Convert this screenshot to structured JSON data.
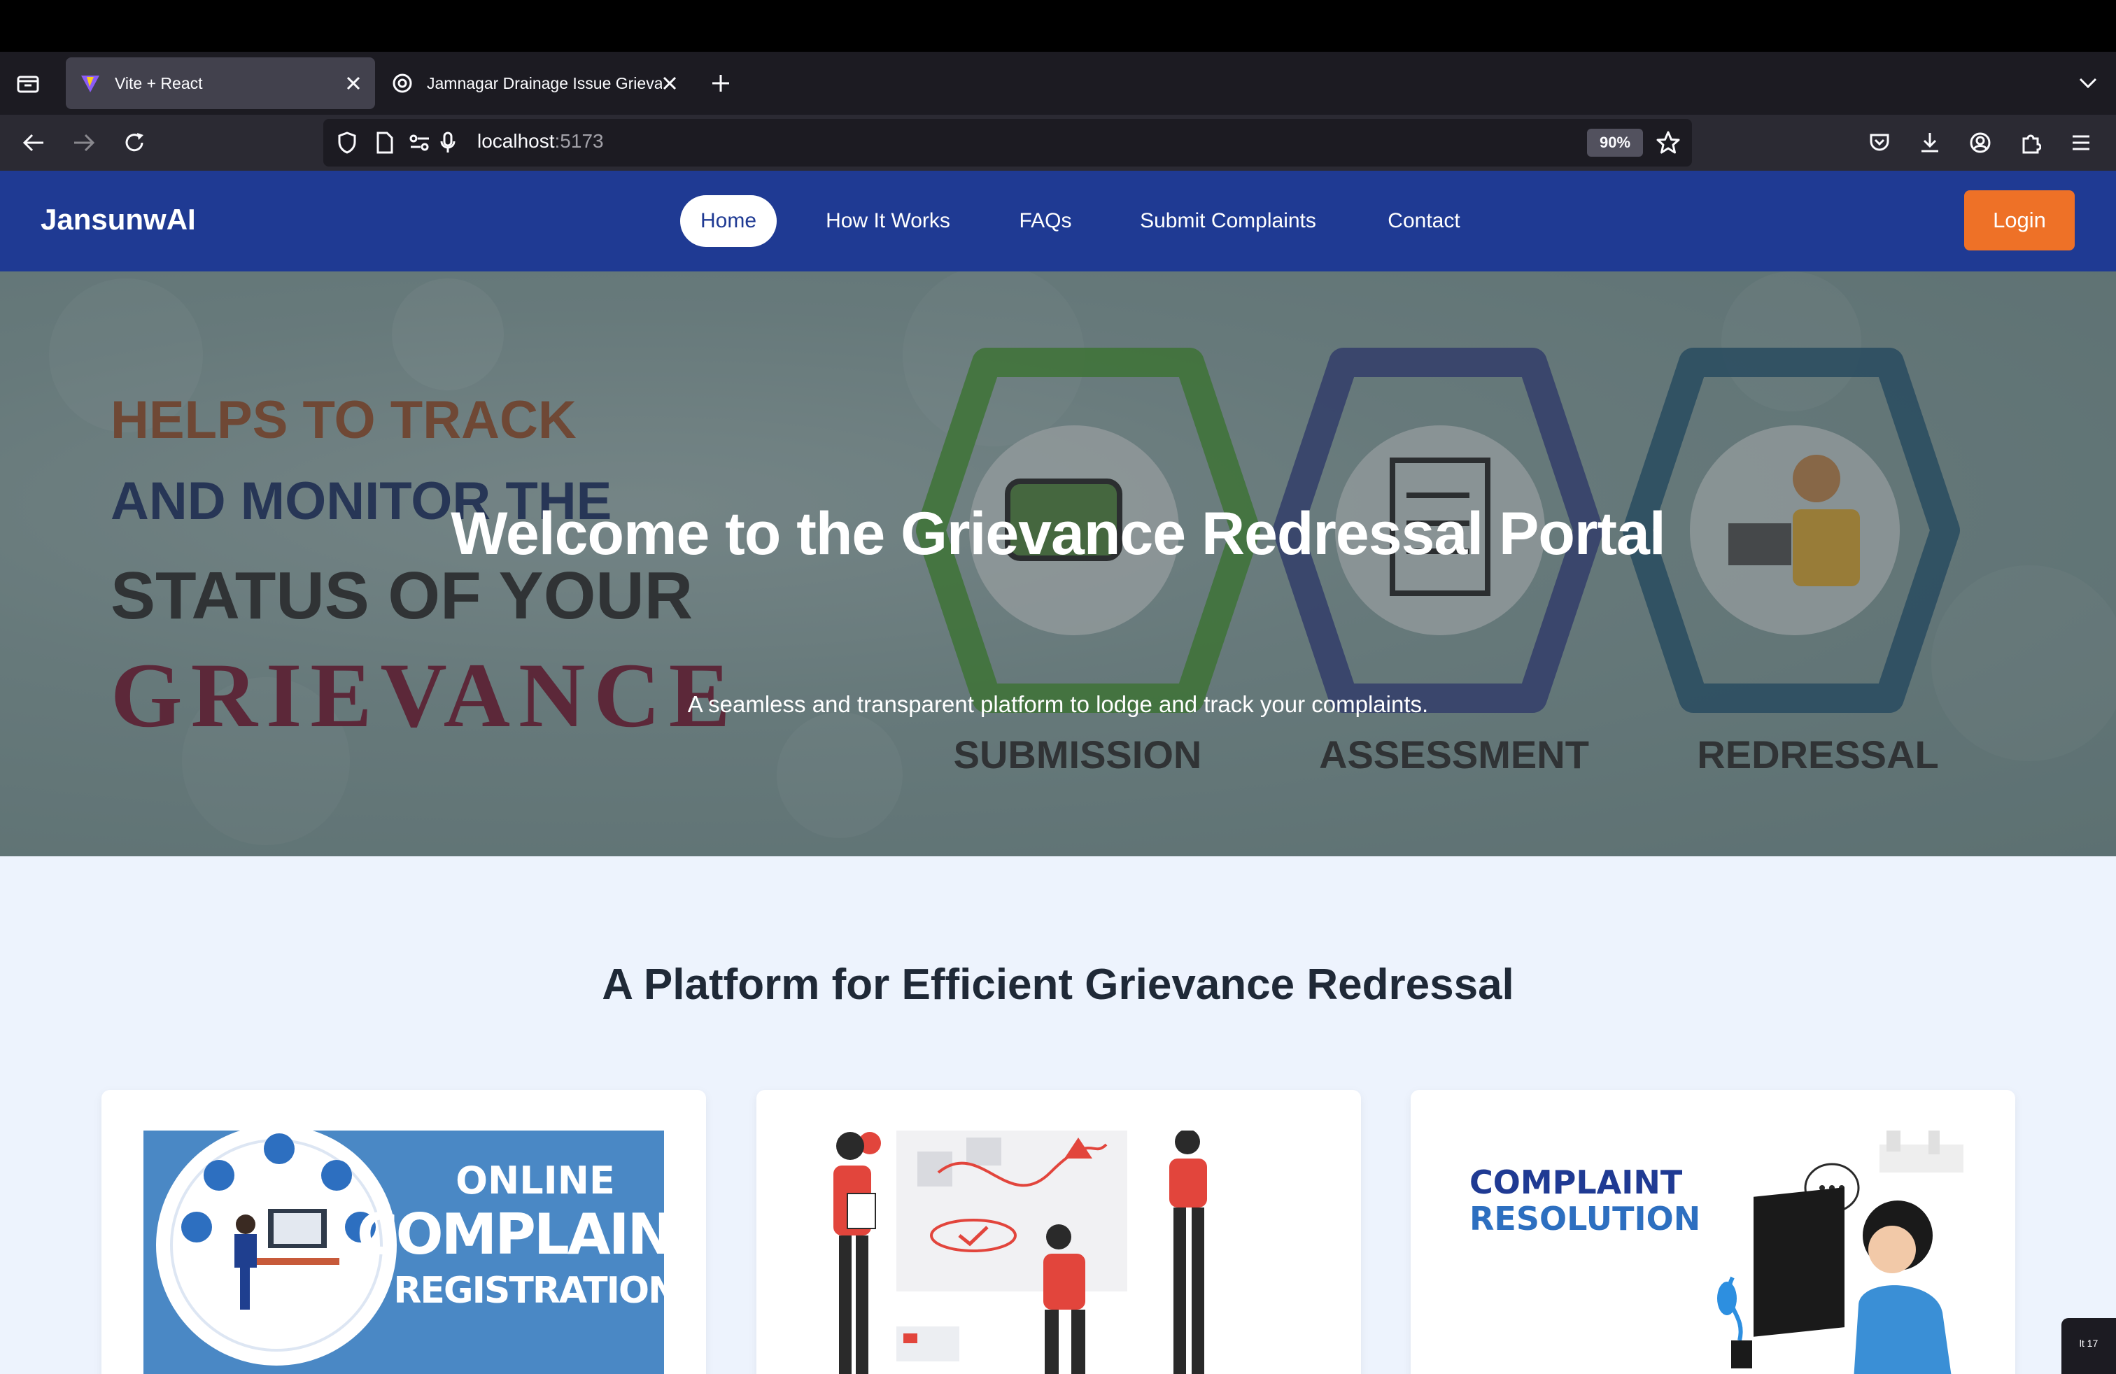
{
  "browser": {
    "tabs": [
      {
        "title": "Vite + React",
        "active": true
      },
      {
        "title": "Jamnagar Drainage Issue Grieva",
        "active": false
      }
    ],
    "url": {
      "host": "localhost",
      "port": ":5173"
    },
    "zoom": "90%"
  },
  "site": {
    "brand": "JansunwAI",
    "nav": [
      "Home",
      "How It Works",
      "FAQs",
      "Submit Complaints",
      "Contact"
    ],
    "login": "Login",
    "hero": {
      "title": "Welcome to the Grievance Redressal Portal",
      "subtitle": "A seamless and transparent platform to lodge and track your complaints.",
      "banner": {
        "line1": "HELPS TO TRACK",
        "line2": "AND MONITOR THE",
        "line3": "STATUS OF YOUR",
        "line4": "GRIEVANCE",
        "step1": "SUBMISSION",
        "step2": "ASSESSMENT",
        "step3": "REDRESSAL"
      }
    },
    "section_title": "A Platform for Efficient Grievance Redressal",
    "cards": [
      {
        "l1": "ONLINE",
        "l2": "COMPLAINT",
        "l3": "REGISTRATION"
      },
      {},
      {
        "l1": "COMPLAINT",
        "l2": "RESOLUTION"
      }
    ]
  },
  "corner_badge": "lt 17",
  "colors": {
    "header": "#1f3a93",
    "login": "#ee7127",
    "page_bg": "#edf3fd",
    "card1_bg": "#4a88c5"
  }
}
